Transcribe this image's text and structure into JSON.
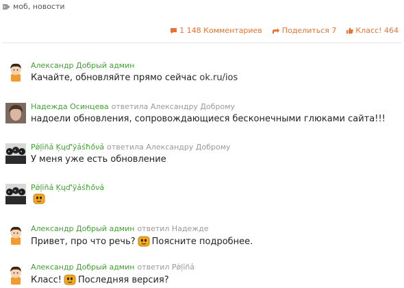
{
  "tags": "моб, новости",
  "actions": {
    "comments": "1 148 Комментариев",
    "share": "Поделиться 7",
    "like": "Класс! 464"
  },
  "comments": [
    {
      "author": "Александр Добрый админ",
      "reply_to": "",
      "text": "Качайте, обновляйте прямо сейчас",
      "link": "ok.ru/ios"
    },
    {
      "author": "Надежда Осинцева",
      "reply_to": "ответила Александру Доброму",
      "text": "надоели обновления, сопровождающиеся бесконечными глюками сайта!!!"
    },
    {
      "author": "Pǿļĭñả Ķųď'ÿảśħồνả",
      "reply_to": "ответила Александру Доброму",
      "text": "У меня уже есть обновление"
    },
    {
      "author": "Pǿļĭñả Ķųď'ÿảśħồνả",
      "reply_to": "",
      "text": ""
    },
    {
      "author": "Александр Добрый админ",
      "reply_to": "ответил Надежде",
      "text": "Привет, про что речь?",
      "text2": "Поясните подробнее."
    },
    {
      "author": "Александр Добрый админ",
      "reply_to": "ответил Pǿļĭñả",
      "text": "Класс!",
      "text2": "Последняя версия?"
    }
  ]
}
